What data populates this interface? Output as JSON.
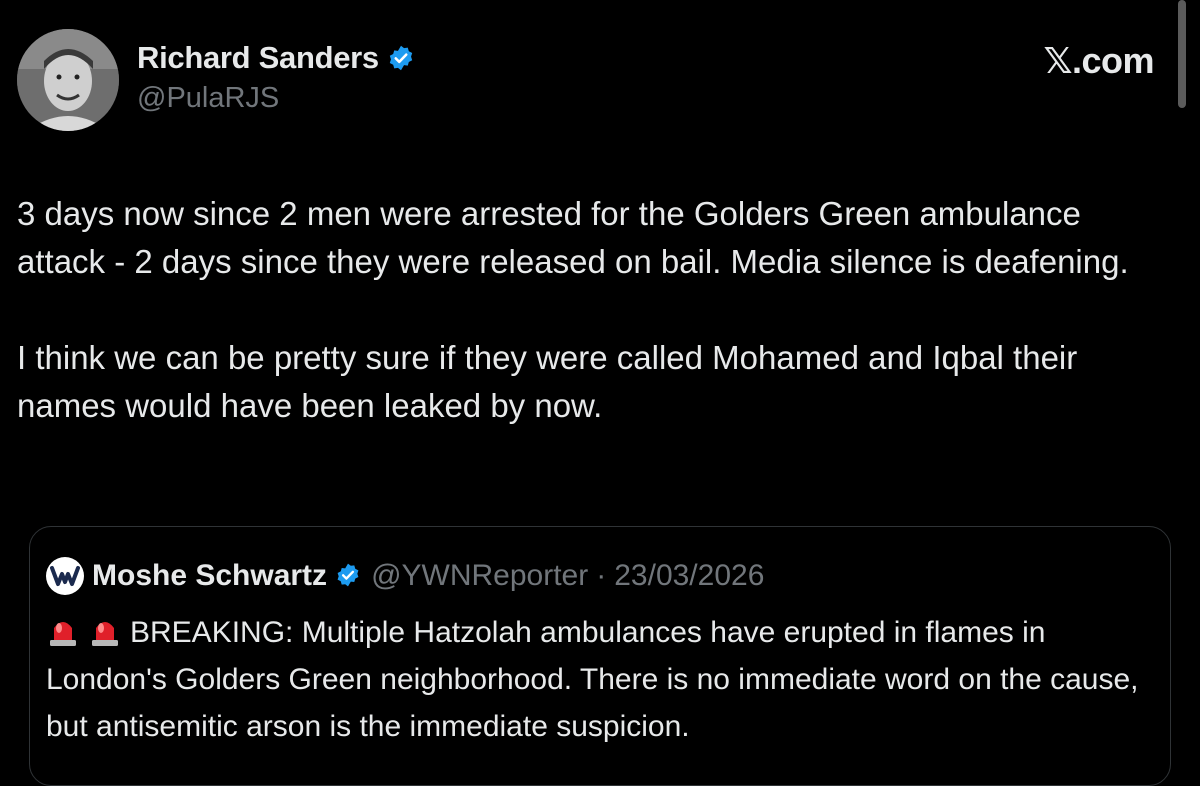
{
  "author": {
    "display_name": "Richard Sanders",
    "handle": "@PulaRJS",
    "verified": true,
    "avatar": "person-photo"
  },
  "brand": "𝕏.com",
  "tweet": {
    "paragraphs": [
      "3 days now since 2 men were arrested for the Golders Green ambulance attack - 2 days since they were released on bail. Media silence is deafening.",
      "I think we can be pretty sure if they were called Mohamed and Iqbal their names would have been leaked by now."
    ]
  },
  "quote": {
    "display_name": "Moshe Schwartz",
    "handle": "@YWNReporter",
    "separator": "·",
    "date": "23/03/2026",
    "verified": true,
    "icons": [
      "siren-icon",
      "siren-icon"
    ],
    "text": "BREAKING: Multiple Hatzolah ambulances have erupted in flames in London's Golders Green neighborhood. There is no immediate word on the cause, but antisemitic arson is the immediate suspicion."
  },
  "colors": {
    "background": "#000000",
    "text": "#e7e9ea",
    "secondary": "#71767b",
    "verified": "#1d9bf0",
    "border": "#2f3336"
  }
}
